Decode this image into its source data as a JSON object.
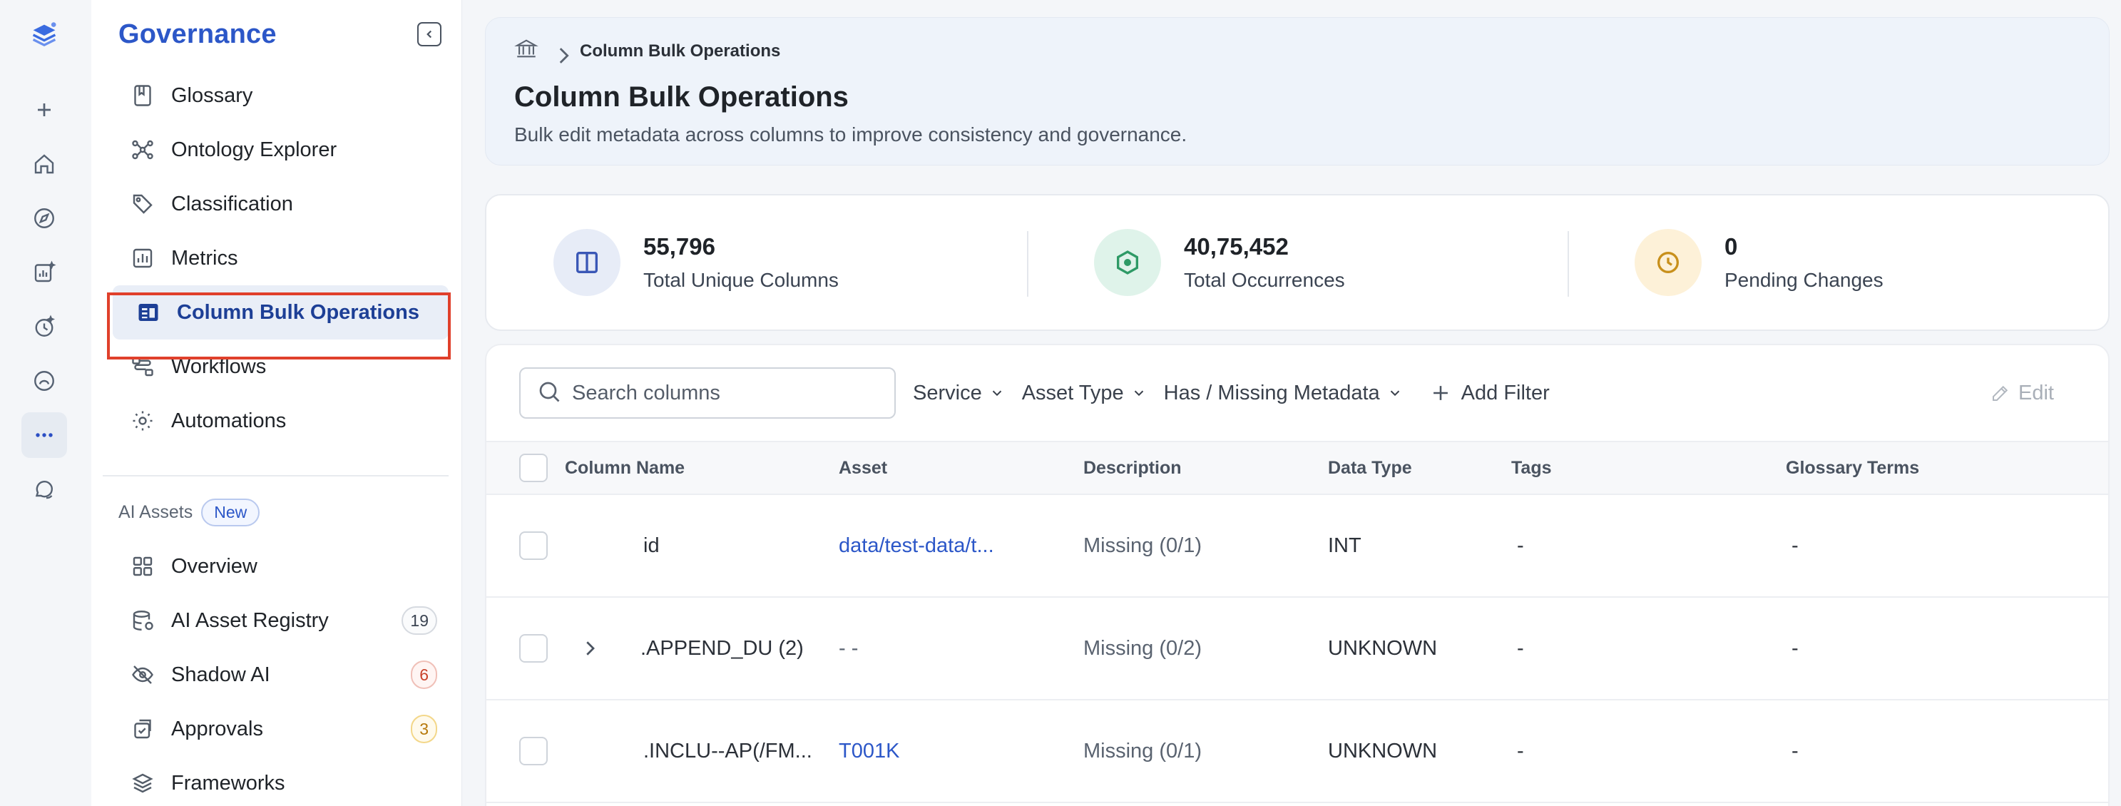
{
  "sidebar": {
    "title": "Governance",
    "items": [
      {
        "label": "Glossary",
        "icon": "book-icon"
      },
      {
        "label": "Ontology Explorer",
        "icon": "graph-icon"
      },
      {
        "label": "Classification",
        "icon": "tag-icon"
      },
      {
        "label": "Metrics",
        "icon": "bar-chart-icon"
      },
      {
        "label": "Column Bulk Operations",
        "icon": "table-edit-icon",
        "active": true
      },
      {
        "label": "Workflows",
        "icon": "workflow-icon"
      },
      {
        "label": "Automations",
        "icon": "automation-icon"
      }
    ],
    "ai_section": {
      "label": "AI Assets",
      "badge": "New",
      "items": [
        {
          "label": "Overview",
          "icon": "grid-icon"
        },
        {
          "label": "AI Asset Registry",
          "icon": "database-icon",
          "count": "19"
        },
        {
          "label": "Shadow AI",
          "icon": "eye-off-icon",
          "count": "6"
        },
        {
          "label": "Approvals",
          "icon": "approval-icon",
          "count": "3"
        },
        {
          "label": "Frameworks",
          "icon": "layers-icon"
        }
      ]
    }
  },
  "header": {
    "breadcrumb": "Column Bulk Operations",
    "title": "Column Bulk Operations",
    "subtitle": "Bulk edit metadata across columns to improve consistency and governance."
  },
  "stats": [
    {
      "value": "55,796",
      "label": "Total Unique Columns"
    },
    {
      "value": "40,75,452",
      "label": "Total Occurrences"
    },
    {
      "value": "0",
      "label": "Pending Changes"
    }
  ],
  "toolbar": {
    "search_placeholder": "Search columns",
    "filters": [
      "Service",
      "Asset Type",
      "Has / Missing Metadata"
    ],
    "add_filter": "Add Filter",
    "edit": "Edit"
  },
  "table": {
    "columns": [
      "Column Name",
      "Asset",
      "Description",
      "Data Type",
      "Tags",
      "Glossary Terms"
    ],
    "rows": [
      {
        "name": "id",
        "asset": "data/test-data/t...",
        "description": "Missing (0/1)",
        "data_type": "INT",
        "tags": "-",
        "glossary": "-"
      },
      {
        "name": ".APPEND_DU (2)",
        "asset": "- -",
        "description": "Missing (0/2)",
        "data_type": "UNKNOWN",
        "tags": "-",
        "glossary": "-"
      },
      {
        "name": ".INCLU--AP(/FM...",
        "asset": "T001K",
        "description": "Missing (0/1)",
        "data_type": "UNKNOWN",
        "tags": "-",
        "glossary": "-"
      }
    ]
  }
}
